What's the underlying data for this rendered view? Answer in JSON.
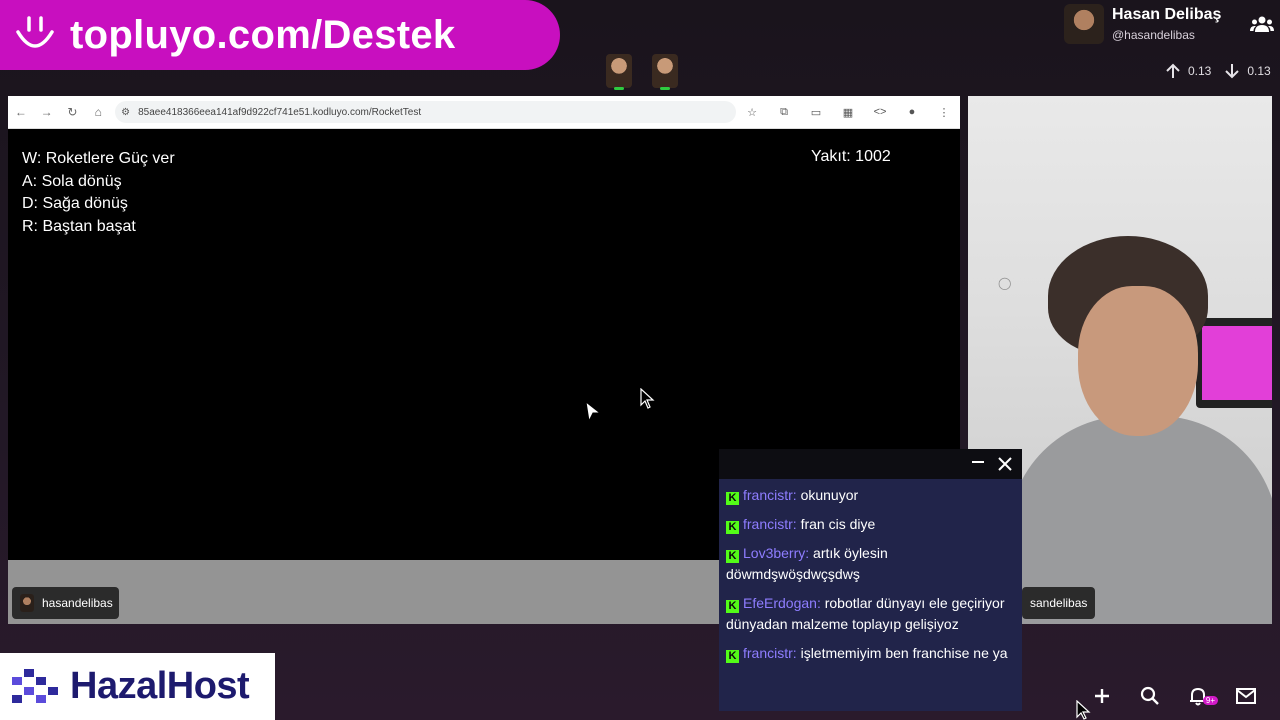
{
  "banner": {
    "text": "topluyo.com/Destek"
  },
  "user": {
    "name": "Hasan Delibaş",
    "handle": "@hasandelibas"
  },
  "rates": {
    "up": "0.13",
    "down": "0.13"
  },
  "browser": {
    "url": "85aee418366eea141af9d922cf741e51.kodluyo.com/RocketTest"
  },
  "game": {
    "lines": [
      "W: Roketlere Güç ver",
      "A: Sola dönüş",
      "D: Sağa dönüş",
      "R: Baştan başat"
    ],
    "fuel": "Yakıt: 1002"
  },
  "tiles": {
    "screen_user": "hasandelibas",
    "cam_user": "sandelibas"
  },
  "chat": {
    "messages": [
      {
        "user": "francistr:",
        "text": "okunuyor"
      },
      {
        "user": "francistr:",
        "text": "fran cis diye"
      },
      {
        "user": "Lov3berry:",
        "text": "artık öylesin döwmdşwöşdwçşdwş"
      },
      {
        "user": "EfeErdogan:",
        "text": "robotlar dünyayı ele geçiriyor dünyadan malzeme toplayıp gelişiyoz"
      },
      {
        "user": "francistr:",
        "text": "işletmemiyim ben franchise ne ya"
      }
    ]
  },
  "logo": {
    "text": "HazalHost"
  },
  "notifications": {
    "badge": "9+"
  },
  "colors": {
    "banner": "#c80fbf",
    "chat_bg": "#21244a",
    "kick_green": "#53fc18",
    "username": "#8e7dff"
  }
}
